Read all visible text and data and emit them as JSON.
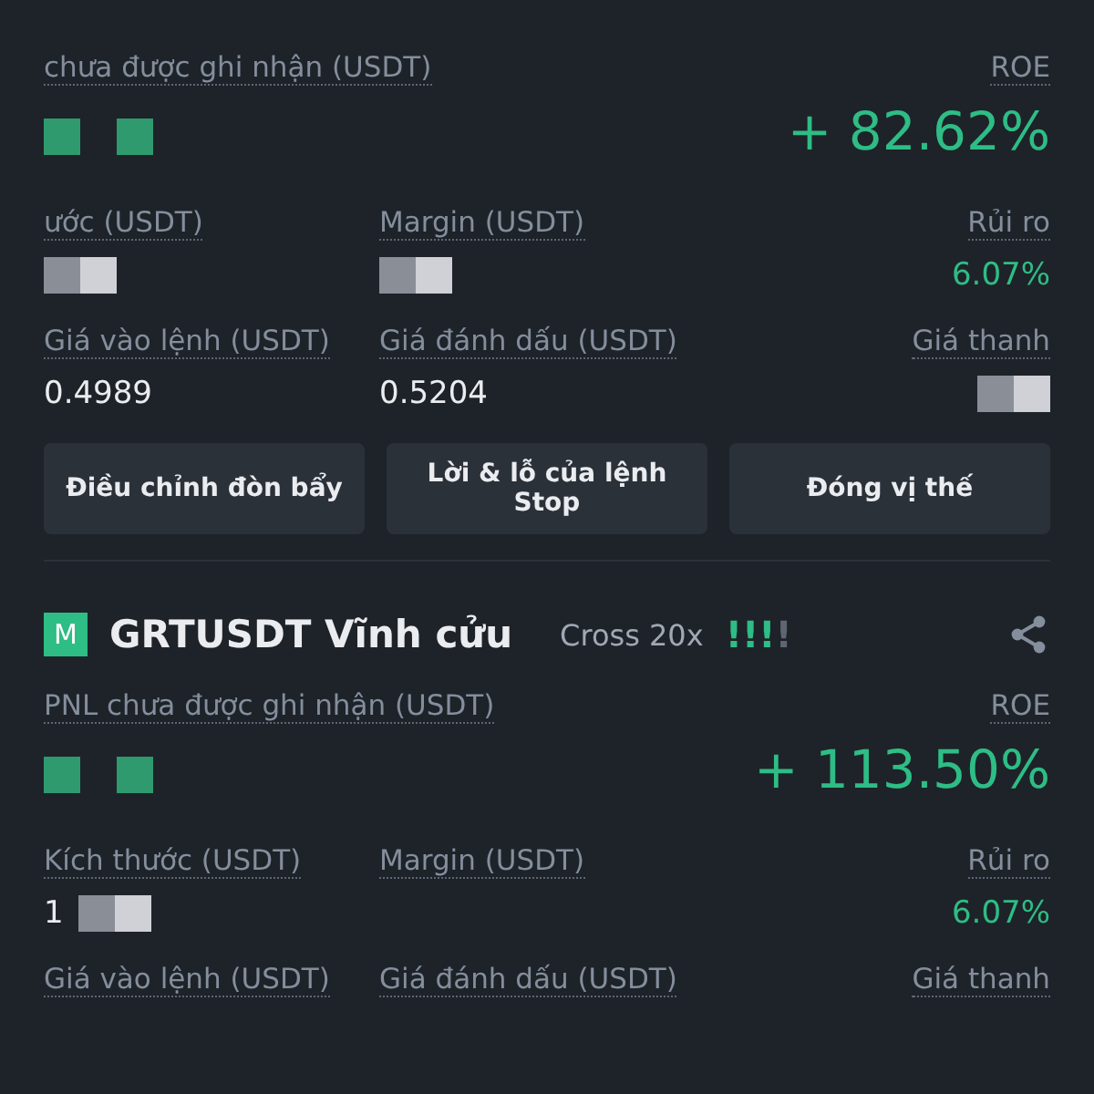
{
  "positions": [
    {
      "pnl": {
        "label": "chưa được ghi nhận (USDT)",
        "masked": true
      },
      "roe": {
        "label": "ROE",
        "value": "+ 82.62%"
      },
      "stats": [
        {
          "label": "ước (USDT)",
          "masked": true
        },
        {
          "label": "Margin (USDT)",
          "masked": true
        },
        {
          "label": "Rủi ro",
          "value": "6.07%"
        }
      ],
      "prices": [
        {
          "label": "Giá vào lệnh (USDT)",
          "value": "0.4989"
        },
        {
          "label": "Giá đánh dấu (USDT)",
          "value": "0.5204"
        },
        {
          "label": "Giá thanh",
          "masked": true
        }
      ],
      "buttons": [
        "Điều chỉnh đòn bẩy",
        "Lời & lỗ của lệnh Stop",
        "Đóng vị thế"
      ]
    },
    {
      "header": {
        "badge": "M",
        "title": "GRTUSDT Vĩnh cửu",
        "mode": "Cross 20x",
        "risk_marks": [
          {
            "text": "!",
            "on": true
          },
          {
            "text": "!",
            "on": true
          },
          {
            "text": "!",
            "on": true
          },
          {
            "text": "!",
            "on": false
          }
        ]
      },
      "pnl": {
        "label": "PNL chưa được ghi nhận (USDT)",
        "masked": true
      },
      "roe": {
        "label": "ROE",
        "value": "+ 113.50%"
      },
      "stats": [
        {
          "label": "Kích thước (USDT)",
          "value": "1",
          "masked": true
        },
        {
          "label": "Margin (USDT)"
        },
        {
          "label": "Rủi ro",
          "value": "6.07%"
        }
      ],
      "prices": [
        {
          "label": "Giá vào lệnh (USDT)"
        },
        {
          "label": "Giá đánh dấu (USDT)"
        },
        {
          "label": "Giá thanh"
        }
      ]
    }
  ]
}
